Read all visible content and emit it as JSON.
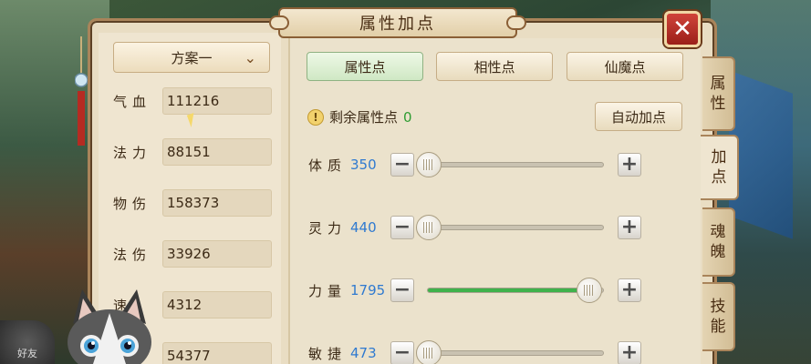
{
  "window": {
    "title": "属性加点",
    "close_label": "✕"
  },
  "plan": {
    "selected": "方案一"
  },
  "stats": [
    {
      "label": "气血",
      "value": "111216"
    },
    {
      "label": "法力",
      "value": "88151"
    },
    {
      "label": "物伤",
      "value": "158373"
    },
    {
      "label": "法伤",
      "value": "33926"
    },
    {
      "label": "速",
      "value": "4312"
    },
    {
      "label": "",
      "value": "54377"
    }
  ],
  "tabs": [
    {
      "label": "属性点",
      "active": true
    },
    {
      "label": "相性点",
      "active": false
    },
    {
      "label": "仙魔点",
      "active": false
    }
  ],
  "remaining": {
    "label": "剩余属性点",
    "value": "0"
  },
  "auto_button": "自动加点",
  "attributes": [
    {
      "label": "体质",
      "value": "350",
      "fill": 0.0
    },
    {
      "label": "灵力",
      "value": "440",
      "fill": 0.0
    },
    {
      "label": "力量",
      "value": "1795",
      "fill": 0.92
    },
    {
      "label": "敏捷",
      "value": "473",
      "fill": 0.0
    }
  ],
  "side_tabs": [
    {
      "label_top": "属",
      "label_bottom": "性"
    },
    {
      "label_top": "加",
      "label_bottom": "点"
    },
    {
      "label_top": "魂",
      "label_bottom": "魄"
    },
    {
      "label_top": "技",
      "label_bottom": "能"
    }
  ],
  "friend_label": "好友",
  "colors": {
    "value_blue": "#2f7ad0",
    "remain_green": "#2e9c32",
    "slider_green": "#3fb24b",
    "close_red": "#c0392b"
  }
}
